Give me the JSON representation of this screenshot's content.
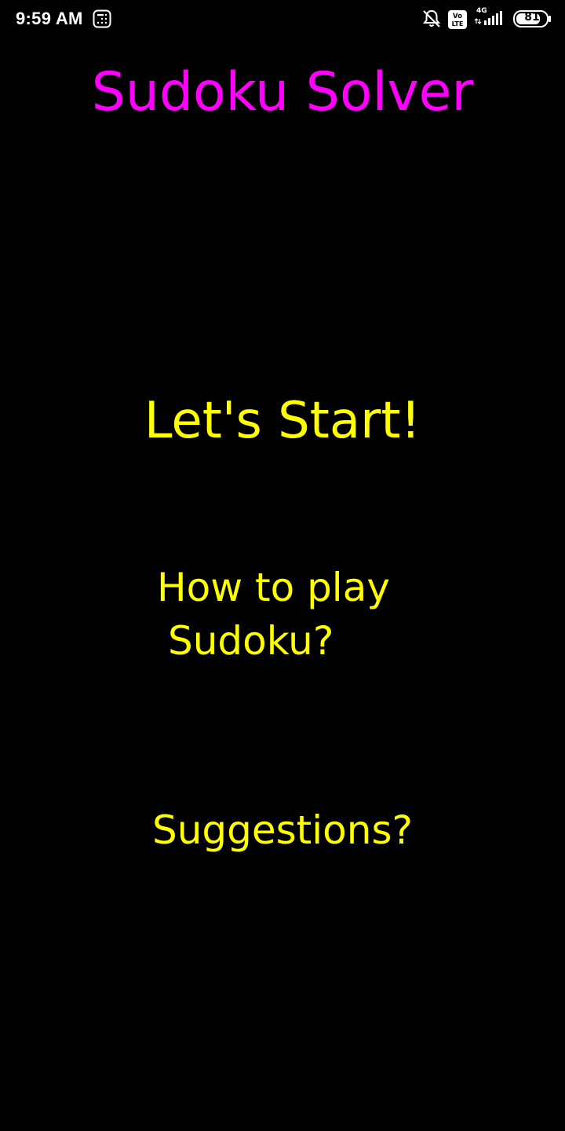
{
  "status_bar": {
    "time": "9:59 AM",
    "network_label": "4G",
    "volte_label": "Vo\nLTE",
    "battery_level": "81",
    "icons": [
      "app-grid-icon",
      "bell-muted-icon",
      "volte-icon",
      "signal-icon",
      "battery-icon"
    ]
  },
  "app": {
    "title": "Sudoku Solver"
  },
  "menu": {
    "start_label": "Let's Start!",
    "how_to_play_line1": "How to play",
    "how_to_play_line2": "Sudoku?",
    "suggestions_label": "Suggestions?"
  },
  "colors": {
    "background": "#000000",
    "title": "#ff00ff",
    "menu_text": "#ffff00",
    "status_text": "#ffffff"
  }
}
